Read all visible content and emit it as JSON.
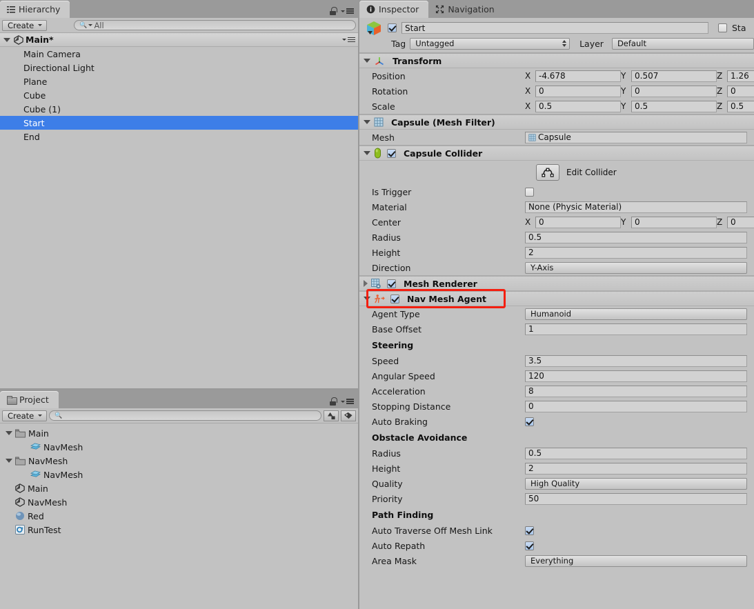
{
  "hierarchy": {
    "tab_label": "Hierarchy",
    "tab_icon": "hierarchy-icon",
    "lock_icon": "lock-icon",
    "menu_icon": "panel-menu-icon",
    "create_label": "Create",
    "search_value": "All",
    "search_placeholder": "All",
    "scene": {
      "name": "Main*",
      "icon": "unity-scene-icon",
      "expanded": true
    },
    "items": [
      {
        "label": "Main Camera",
        "selected": false
      },
      {
        "label": "Directional Light",
        "selected": false
      },
      {
        "label": "Plane",
        "selected": false
      },
      {
        "label": "Cube",
        "selected": false
      },
      {
        "label": "Cube (1)",
        "selected": false
      },
      {
        "label": "Start",
        "selected": true
      },
      {
        "label": "End",
        "selected": false
      }
    ],
    "selection_color": "#3d7ee8"
  },
  "project": {
    "tab_label": "Project",
    "tab_icon": "folder-icon",
    "lock_icon": "lock-icon",
    "menu_icon": "panel-menu-icon",
    "create_label": "Create",
    "search_value": "",
    "search_placeholder": "",
    "filter_type_icon": "filter-by-type-icon",
    "filter_label_icon": "filter-by-label-icon",
    "items": [
      {
        "label": "Main",
        "icon": "folder-icon",
        "indent": 0,
        "expanded": true
      },
      {
        "label": "NavMesh",
        "icon": "navmesh-asset-icon",
        "indent": 1,
        "expanded": null
      },
      {
        "label": "NavMesh",
        "icon": "folder-icon",
        "indent": 0,
        "expanded": true
      },
      {
        "label": "NavMesh",
        "icon": "navmesh-asset-icon",
        "indent": 1,
        "expanded": null
      },
      {
        "label": "Main",
        "icon": "unity-scene-icon",
        "indent": 0,
        "expanded": null
      },
      {
        "label": "NavMesh",
        "icon": "unity-scene-icon",
        "indent": 0,
        "expanded": null
      },
      {
        "label": "Red",
        "icon": "material-icon",
        "indent": 0,
        "expanded": null
      },
      {
        "label": "RunTest",
        "icon": "csharp-script-icon",
        "indent": 0,
        "expanded": null
      }
    ]
  },
  "inspector": {
    "tabs": [
      {
        "label": "Inspector",
        "icon": "info-icon",
        "active": true
      },
      {
        "label": "Navigation",
        "icon": "navigation-icon",
        "active": false
      }
    ],
    "object": {
      "icon": "prefab-cube-icon",
      "enabled": true,
      "name": "Start",
      "static_label": "Sta",
      "static_checked": false,
      "tag_label": "Tag",
      "tag_value": "Untagged",
      "layer_label": "Layer",
      "layer_value": "Default"
    },
    "components": [
      {
        "name": "Transform",
        "icon": "transform-icon",
        "expanded": true,
        "has_enable_checkbox": false,
        "rows": [
          {
            "type": "vector3",
            "label": "Position",
            "x": "-4.678",
            "y": "0.507",
            "z": "1.26"
          },
          {
            "type": "vector3",
            "label": "Rotation",
            "x": "0",
            "y": "0",
            "z": "0"
          },
          {
            "type": "vector3",
            "label": "Scale",
            "x": "0.5",
            "y": "0.5",
            "z": "0.5"
          }
        ]
      },
      {
        "name": "Capsule (Mesh Filter)",
        "icon": "mesh-filter-icon",
        "expanded": true,
        "has_enable_checkbox": false,
        "rows": [
          {
            "type": "object",
            "label": "Mesh",
            "value": "Capsule",
            "value_icon": "mesh-icon"
          }
        ]
      },
      {
        "name": "Capsule Collider",
        "icon": "capsule-collider-icon",
        "expanded": true,
        "has_enable_checkbox": true,
        "enabled": true,
        "rows": [
          {
            "type": "editcollider",
            "label": "",
            "button_icon": "edit-collider-icon",
            "button_label": "Edit Collider"
          },
          {
            "type": "checkbox",
            "label": "Is Trigger",
            "checked": false
          },
          {
            "type": "object",
            "label": "Material",
            "value": "None (Physic Material)"
          },
          {
            "type": "vector3",
            "label": "Center",
            "x": "0",
            "y": "0",
            "z": "0"
          },
          {
            "type": "text",
            "label": "Radius",
            "value": "0.5"
          },
          {
            "type": "text",
            "label": "Height",
            "value": "2"
          },
          {
            "type": "dropdown",
            "label": "Direction",
            "value": "Y-Axis"
          }
        ]
      },
      {
        "name": "Mesh Renderer",
        "icon": "mesh-renderer-icon",
        "expanded": false,
        "has_enable_checkbox": true,
        "enabled": true,
        "rows": []
      },
      {
        "name": "Nav Mesh Agent",
        "icon": "nav-mesh-agent-icon",
        "expanded": true,
        "has_enable_checkbox": true,
        "enabled": true,
        "highlighted": true,
        "rows": [
          {
            "type": "dropdown",
            "label": "Agent Type",
            "value": "Humanoid"
          },
          {
            "type": "text",
            "label": "Base Offset",
            "value": "1"
          },
          {
            "type": "section",
            "label": "Steering"
          },
          {
            "type": "text",
            "label": "Speed",
            "value": "3.5"
          },
          {
            "type": "text",
            "label": "Angular Speed",
            "value": "120"
          },
          {
            "type": "text",
            "label": "Acceleration",
            "value": "8"
          },
          {
            "type": "text",
            "label": "Stopping Distance",
            "value": "0"
          },
          {
            "type": "checkbox",
            "label": "Auto Braking",
            "checked": true
          },
          {
            "type": "section",
            "label": "Obstacle Avoidance"
          },
          {
            "type": "text",
            "label": "Radius",
            "value": "0.5"
          },
          {
            "type": "text",
            "label": "Height",
            "value": "2"
          },
          {
            "type": "dropdown",
            "label": "Quality",
            "value": "High Quality"
          },
          {
            "type": "text",
            "label": "Priority",
            "value": "50"
          },
          {
            "type": "section",
            "label": "Path Finding"
          },
          {
            "type": "checkbox",
            "label": "Auto Traverse Off Mesh Link",
            "checked": true
          },
          {
            "type": "checkbox",
            "label": "Auto Repath",
            "checked": true
          },
          {
            "type": "dropdown",
            "label": "Area Mask",
            "value": "Everything"
          }
        ]
      }
    ],
    "annotation": {
      "color": "#f41f10",
      "target": "Nav Mesh Agent"
    }
  }
}
